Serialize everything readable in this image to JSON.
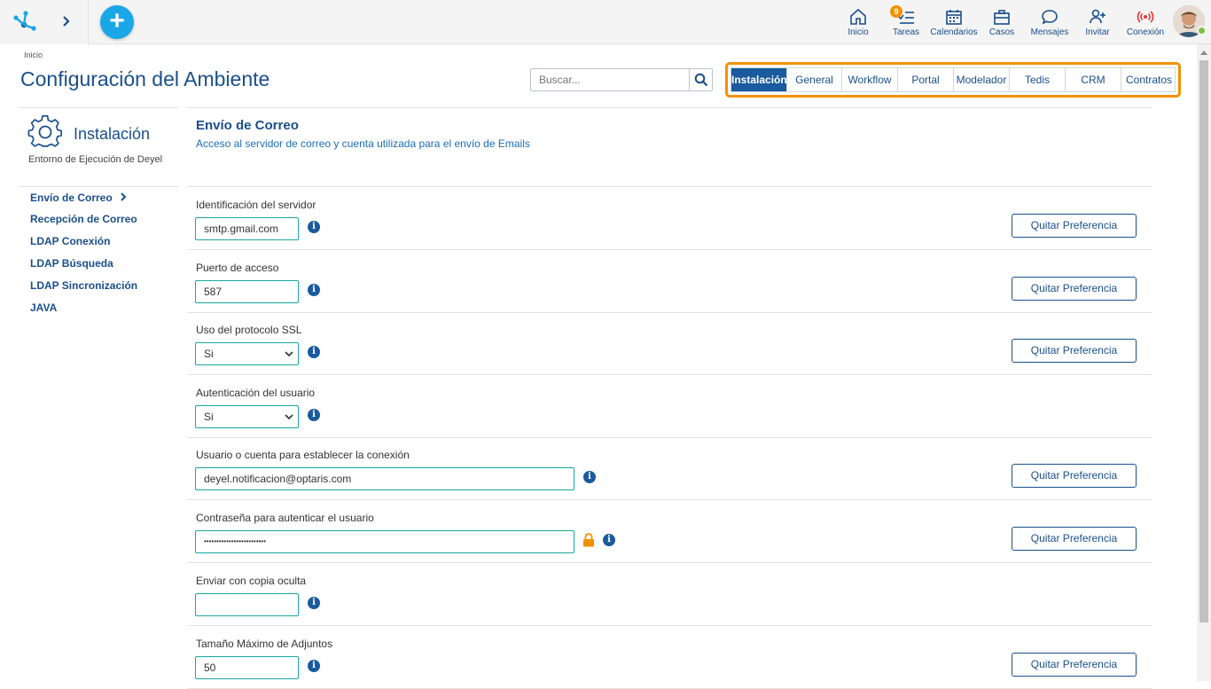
{
  "topbar": {
    "nav": [
      {
        "label": "Inicio",
        "icon": "home-icon"
      },
      {
        "label": "Tareas",
        "icon": "tasks-icon",
        "badge": "9"
      },
      {
        "label": "Calendarios",
        "icon": "calendar-icon"
      },
      {
        "label": "Casos",
        "icon": "briefcase-icon"
      },
      {
        "label": "Mensajes",
        "icon": "chat-icon"
      },
      {
        "label": "Invitar",
        "icon": "invite-user-icon"
      },
      {
        "label": "Conexión",
        "icon": "connection-icon"
      }
    ],
    "plus_label": "+"
  },
  "header": {
    "breadcrumb": "Inicio",
    "title": "Configuración del Ambiente",
    "search_placeholder": "Buscar..."
  },
  "tabs": [
    {
      "label": "Instalación",
      "active": true
    },
    {
      "label": "General"
    },
    {
      "label": "Workflow"
    },
    {
      "label": "Portal"
    },
    {
      "label": "Modelador"
    },
    {
      "label": "Tedis"
    },
    {
      "label": "CRM"
    },
    {
      "label": "Contratos"
    }
  ],
  "sidebar": {
    "title": "Instalación",
    "subtitle": "Entorno de Ejecución de Deyel",
    "items": [
      {
        "label": "Envío de Correo",
        "active": true
      },
      {
        "label": "Recepción de Correo"
      },
      {
        "label": "LDAP Conexión"
      },
      {
        "label": "LDAP Búsqueda"
      },
      {
        "label": "LDAP Sincronización"
      },
      {
        "label": "JAVA"
      }
    ]
  },
  "section": {
    "title": "Envío de Correo",
    "description": "Acceso al servidor de correo y cuenta utilizada para el envío de Emails"
  },
  "settings": [
    {
      "label": "Identificación del servidor",
      "value": "smtp.gmail.com",
      "type": "text",
      "has_quit": true
    },
    {
      "label": "Puerto de acceso",
      "value": "587",
      "type": "text",
      "has_quit": true
    },
    {
      "label": "Uso del protocolo SSL",
      "value": "Si",
      "type": "select",
      "has_quit": true
    },
    {
      "label": "Autenticación del usuario",
      "value": "Si",
      "type": "select",
      "has_quit": false
    },
    {
      "label": "Usuario o cuenta para establecer la conexión",
      "value": "deyel.notificacion@optaris.com",
      "type": "text-wide",
      "has_quit": true
    },
    {
      "label": "Contraseña para autenticar el usuario",
      "value": "•••••••••••••••••••••••••",
      "type": "password",
      "has_quit": true
    },
    {
      "label": "Enviar con copia oculta",
      "value": "",
      "type": "text",
      "has_quit": false
    },
    {
      "label": "Tamaño Máximo de Adjuntos",
      "value": "50",
      "type": "text",
      "has_quit": true
    }
  ],
  "quit_label": "Quitar Preferencia",
  "info_glyph": "i",
  "colors": {
    "primary": "#1a4f8b",
    "accent": "#19a7e8",
    "highlight": "#f29100",
    "field_border": "#19a7a0"
  }
}
